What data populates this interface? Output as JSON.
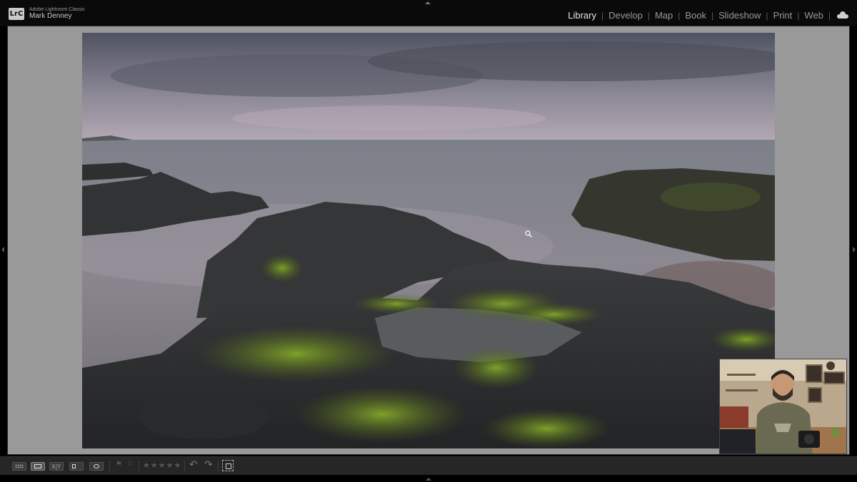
{
  "app": {
    "badge": "LrC",
    "name": "Adobe Lightroom Classic",
    "user": "Mark Denney"
  },
  "modules": [
    {
      "label": "Library",
      "active": true
    },
    {
      "label": "Develop",
      "active": false
    },
    {
      "label": "Map",
      "active": false
    },
    {
      "label": "Book",
      "active": false
    },
    {
      "label": "Slideshow",
      "active": false
    },
    {
      "label": "Print",
      "active": false
    },
    {
      "label": "Web",
      "active": false
    }
  ],
  "separator": "|",
  "icons": {
    "cloud": "cloud-icon",
    "zoom_cursor": "magnifier-cursor-icon",
    "crop": "crop-overlay-icon"
  },
  "toolbar": {
    "views": [
      "grid-view",
      "loupe-view",
      "compare-view",
      "survey-view",
      "people-view"
    ],
    "active_view": "loupe-view",
    "compare_glyph": "X|Y",
    "flags": [
      "⚑",
      "⚐"
    ],
    "rating": "★★★★★",
    "rotate_left": "↶",
    "rotate_right": "↷"
  },
  "colors": {
    "topbar_bg": "#0a0a0a",
    "main_bg": "#999999",
    "toolbar_bg": "#262626",
    "active_module": "#e8e8e8",
    "inactive_module": "#9a9a9a"
  }
}
